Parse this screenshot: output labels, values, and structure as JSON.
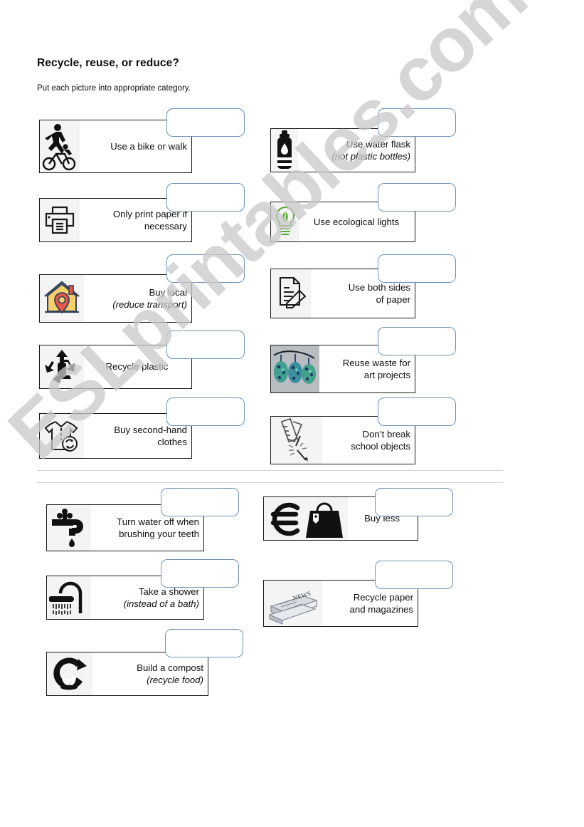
{
  "header": {
    "title": "Recycle, reuse, or reduce?",
    "subtitle": "Put each picture into appropriate category."
  },
  "watermark": {
    "text": "ESLprintables.com"
  },
  "sections": [
    {
      "name": "top-section",
      "items": [
        {
          "id": "use-a-bike-or-walk",
          "icon": "walk-bike-icon",
          "line1": "Use a bike or walk",
          "line2": ""
        },
        {
          "id": "use-water-flask",
          "icon": "water-flask-icon",
          "line1": "Use water flask",
          "line2": "(not plastic bottles)"
        },
        {
          "id": "only-print-paper",
          "icon": "printer-icon",
          "line1": "Only print paper if",
          "line2": "necessary"
        },
        {
          "id": "use-ecological-lights",
          "icon": "eco-lightbulb-icon",
          "line1": "Use ecological lights",
          "line2": ""
        },
        {
          "id": "buy-local",
          "icon": "house-pin-icon",
          "line1": "Buy local",
          "line2": "(reduce transport)"
        },
        {
          "id": "use-both-sides-of-paper",
          "icon": "paper-pencil-icon",
          "line1": "Use both sides",
          "line2": "of paper"
        },
        {
          "id": "recycle-plastic",
          "icon": "recycle-bottle-icon",
          "line1": "Recycle plastic",
          "line2": ""
        },
        {
          "id": "reuse-waste-for-art",
          "icon": "craft-ornaments-icon",
          "line1": "Reuse waste for",
          "line2": "art projects"
        },
        {
          "id": "buy-second-hand-clothes",
          "icon": "shirt-recycle-icon",
          "line1": "Buy second-hand",
          "line2": "clothes"
        },
        {
          "id": "dont-break-school-objects",
          "icon": "broken-ruler-icon",
          "line1": "Don’t break",
          "line2": "school objects"
        }
      ]
    },
    {
      "name": "bottom-section",
      "items": [
        {
          "id": "turn-water-off",
          "icon": "faucet-icon",
          "line1": "Turn water off when",
          "line2": "brushing your teeth"
        },
        {
          "id": "buy-less",
          "icon": "euro-bag-icon",
          "line1": "Buy less",
          "line2": ""
        },
        {
          "id": "take-a-shower",
          "icon": "shower-icon",
          "line1": "Take a shower",
          "line2": "(instead of a bath)"
        },
        {
          "id": "recycle-paper",
          "icon": "newspapers-icon",
          "line1": "Recycle paper",
          "line2": "and magazines"
        },
        {
          "id": "build-a-compost",
          "icon": "compost-icon",
          "line1": "Build a compost",
          "line2": "(recycle food)"
        }
      ]
    }
  ],
  "answer_boxes": {
    "count": 15,
    "value": "",
    "placeholder": ""
  },
  "colors": {
    "card_border": "#1b1b1b",
    "answer_border": "#6f93b4",
    "divider": "#d2d2d2",
    "watermark": "#c9c9c9",
    "eco_green": "#5aa832",
    "house_yellow": "#f5d06a",
    "pin_red": "#e8564a",
    "craft_teal": "#2e8b9e"
  }
}
